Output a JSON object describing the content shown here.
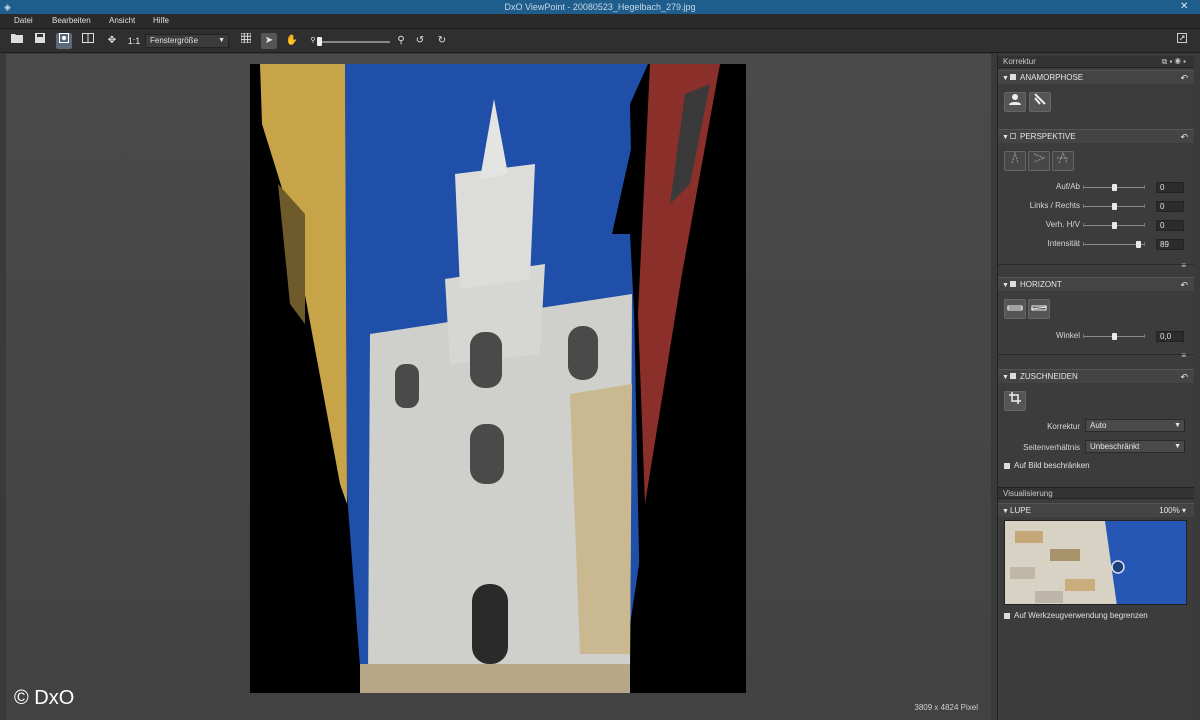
{
  "window": {
    "title": "DxO ViewPoint - 20080523_Hegelbach_279.jpg"
  },
  "menu": [
    "Datei",
    "Bearbeiten",
    "Ansicht",
    "Hilfe"
  ],
  "toolbar": {
    "one_to_one": "1:1",
    "zoom_mode": "Fenstergröße"
  },
  "image": {
    "pixel_info": "3809 x 4824 Pixel"
  },
  "watermark": "© DxO",
  "sidebar": {
    "korrektur_title": "Korrektur",
    "anamorphose": {
      "title": "ANAMORPHOSE"
    },
    "perspektive": {
      "title": "PERSPEKTIVE",
      "rows": [
        {
          "label": "Auf/Ab",
          "value": "0",
          "level": 0.5
        },
        {
          "label": "Links / Rechts",
          "value": "0",
          "level": 0.5
        },
        {
          "label": "Verh. H/V",
          "value": "0",
          "level": 0.5
        },
        {
          "label": "Intensität",
          "value": "89",
          "level": 0.89
        }
      ]
    },
    "horizont": {
      "title": "HORIZONT",
      "rows": [
        {
          "label": "Winkel",
          "value": "0,0",
          "level": 0.5
        }
      ]
    },
    "zuschneiden": {
      "title": "ZUSCHNEIDEN",
      "korrektur_label": "Korrektur",
      "korrektur_value": "Auto",
      "seiten_label": "Seitenverhältnis",
      "seiten_value": "Unbeschränkt",
      "restrict_label": "Auf Bild beschränken"
    },
    "visualisierung_title": "Visualisierung",
    "lupe": {
      "title": "LUPE",
      "zoom": "100%",
      "limit_label": "Auf Werkzeugverwendung begrenzen"
    }
  },
  "colors": {
    "titlebar": "#1e5d8c",
    "sky": "#1f4fa8",
    "active_tool": "#5a6a7a"
  }
}
